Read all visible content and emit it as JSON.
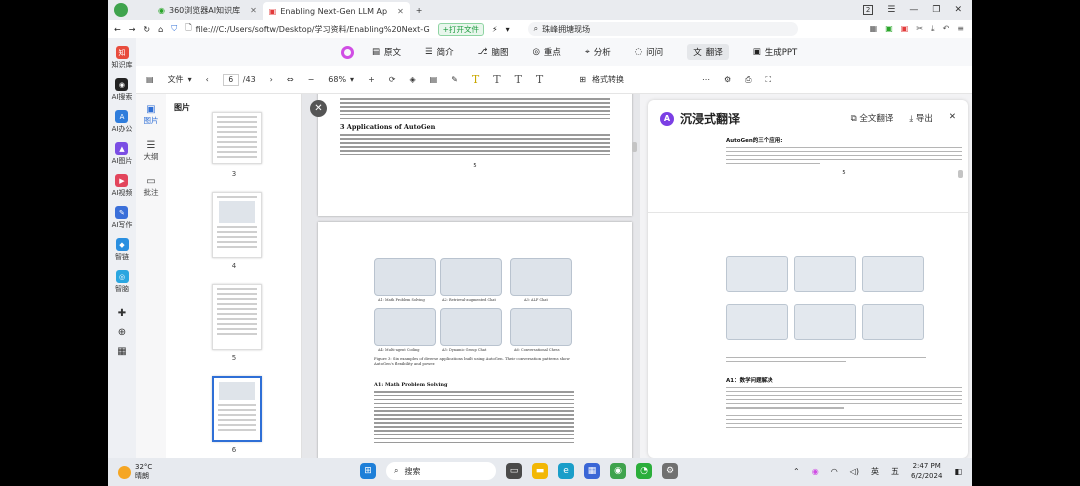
{
  "tabs": [
    {
      "label": "360浏览器AI知识库"
    },
    {
      "label": "Enabling Next-Gen LLM Ap"
    }
  ],
  "tab_count": "2",
  "address": {
    "url": "file:///C:/Users/softw/Desktop/学习资料/Enabling%20Next-G",
    "open_client": "+打开文件",
    "search_text": "珠峰拥塘现场"
  },
  "apps": [
    {
      "label": "知识库",
      "color": "#e84c3d"
    },
    {
      "label": "AI搜索",
      "color": "#222222"
    },
    {
      "label": "AI办公",
      "color": "#2f7ddc"
    },
    {
      "label": "AI图片",
      "color": "#7b4ee4"
    },
    {
      "label": "AI视频",
      "color": "#e2455c"
    },
    {
      "label": "AI写作",
      "color": "#3a6fd9"
    },
    {
      "label": "智链",
      "color": "#2a8fe0"
    },
    {
      "label": "智脑",
      "color": "#2aa6e0"
    }
  ],
  "ai_toolbar": [
    "原文",
    "简介",
    "脑图",
    "重点",
    "分析",
    "问问",
    "翻译",
    "生成PPT"
  ],
  "pdf_toolbar": {
    "file": "文件",
    "page": "6",
    "total": "/43",
    "zoom": "68%",
    "format_convert": "格式转换"
  },
  "pdf_side": [
    "图片",
    "大纲",
    "批注"
  ],
  "thumbs": {
    "title": "图片",
    "pages": [
      "3",
      "4",
      "5",
      "6"
    ]
  },
  "pdf_page1": {
    "section": "3    Applications of AutoGen",
    "page_no": "5"
  },
  "pdf_page2": {
    "fig_labels": [
      "A1: Math Problem Solving",
      "A2: Retrieval-augmented Chat",
      "A3: ALF Chat",
      "A4: Multi-agent Coding",
      "A5: Dynamic Group Chat",
      "A6: Conversational Chess"
    ],
    "fig_caption": "Figure 3: Six examples of diverse applications built using AutoGen. Their conversation patterns show AutoGen's flexibility and power.",
    "subhead": "A1: Math Problem Solving"
  },
  "translation": {
    "title": "沉浸式翻译",
    "full_translate": "全文翻译",
    "export": "导出",
    "section_title": "AutoGen的三个应用:",
    "page_no": "5",
    "subhead": "A1：数学问题解决"
  },
  "taskbar": {
    "temp": "32°C",
    "weather": "晴朗",
    "search": "搜索",
    "lang": "英",
    "ime": "五",
    "time": "2:47 PM",
    "date": "6/2/2024"
  }
}
